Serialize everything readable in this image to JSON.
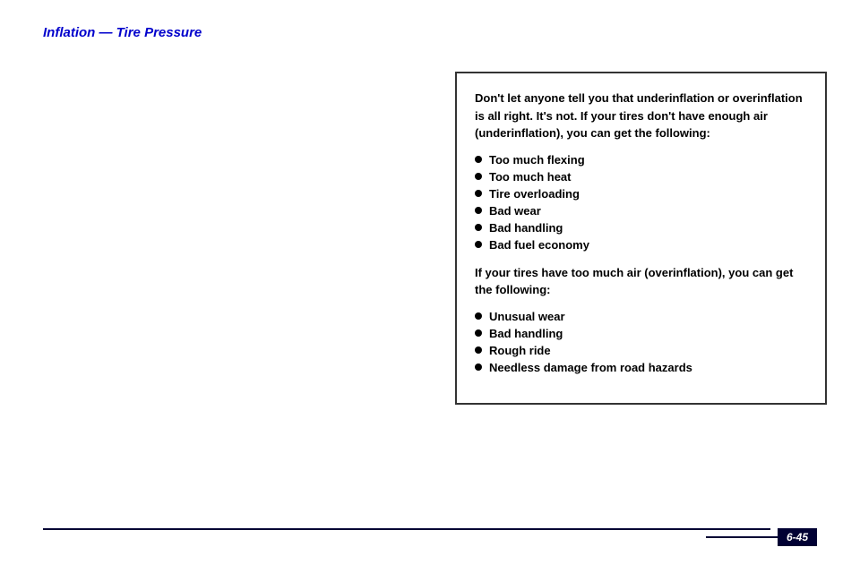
{
  "page": {
    "title": "Inflation — Tire Pressure",
    "page_number": "6-45"
  },
  "info_box": {
    "intro_text": "Don't let anyone tell you that underinflation or overinflation is all right. It's not. If your tires don't have enough air (underinflation), you can get the following:",
    "underinflation_items": [
      "Too much flexing",
      "Too much heat",
      "Tire overloading",
      "Bad wear",
      "Bad handling",
      "Bad fuel economy"
    ],
    "overinflation_intro": "If your tires have too much air (overinflation), you can get the following:",
    "overinflation_items": [
      "Unusual wear",
      "Bad handling",
      "Rough ride",
      "Needless damage from road hazards"
    ]
  },
  "colors": {
    "title_color": "#0000cc",
    "border_color": "#333333",
    "text_color": "#000000",
    "page_num_bg": "#000033",
    "page_num_text": "#ffffff",
    "line_color": "#000033"
  }
}
